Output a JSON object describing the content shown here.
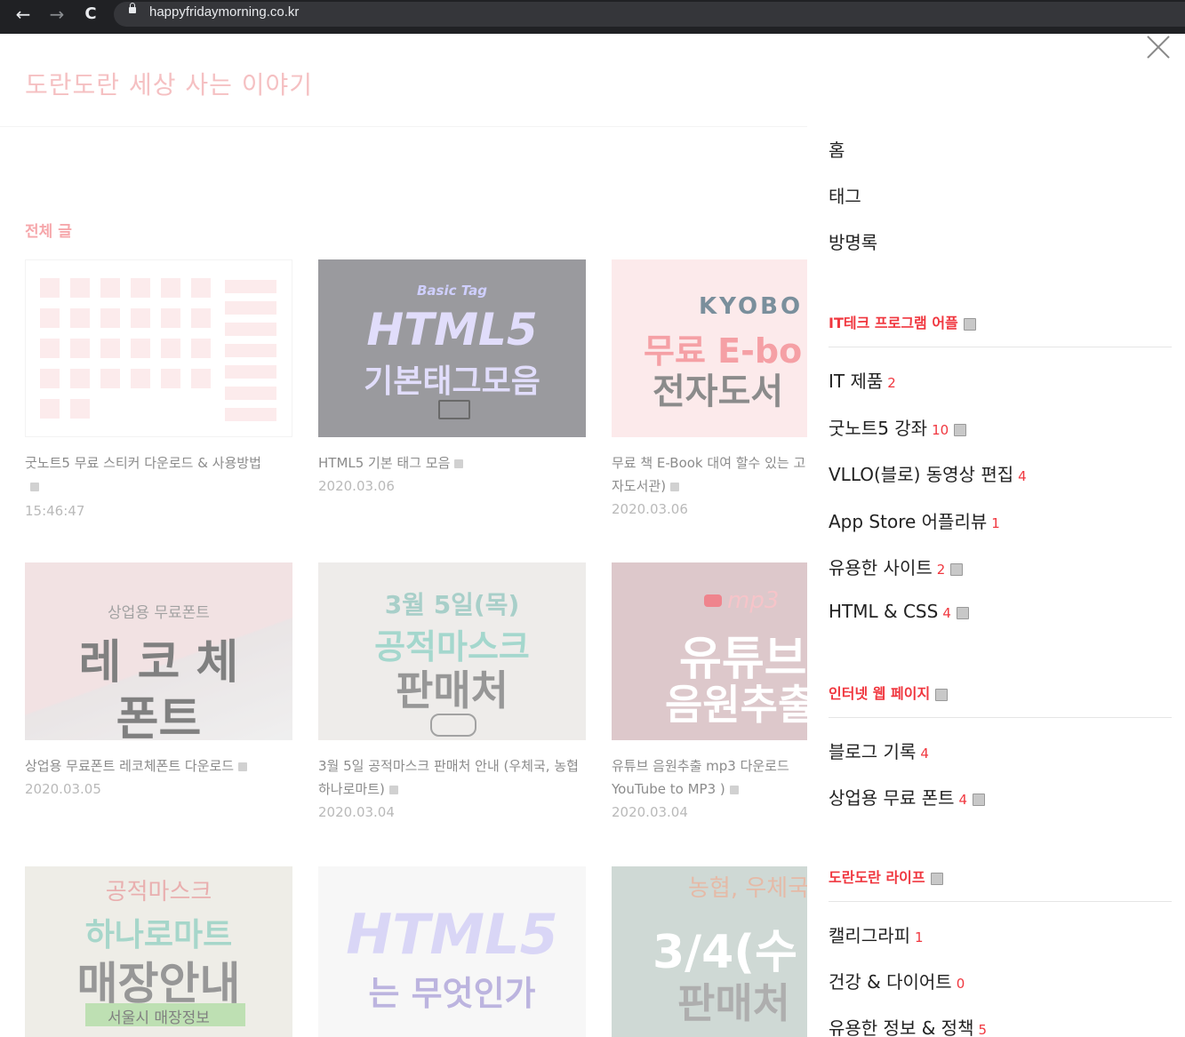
{
  "browser": {
    "url": "happyfridaymorning.co.kr",
    "back": "←",
    "forward": "→",
    "reload": "C"
  },
  "blog": {
    "title": "도란도란 세상 사는 이야기"
  },
  "section": {
    "title": "전체 글"
  },
  "posts": [
    {
      "title": "굿노트5 무료 스티커 다운로드 & 사용방법",
      "date": "15:46:47"
    },
    {
      "title": "HTML5 기본 태그 모음",
      "date": "2020.03.06",
      "thumb_small": "Basic Tag",
      "thumb_big": "HTML5",
      "thumb_sub": "기본태그모음"
    },
    {
      "title": "무료 책 E-Book 대여 할수 있는 고 전자도서관)",
      "date": "2020.03.06",
      "thumb_small": "KYOBO",
      "thumb_big": "무료 E-bo",
      "thumb_sub": "전자도서"
    },
    {
      "title": "상업용 무료폰트 레코체폰트 다운로드",
      "date": "2020.03.05",
      "thumb_small": "상업용 무료폰트",
      "thumb_big": "레 코 체",
      "thumb_sub": "폰트"
    },
    {
      "title": "3월 5일 공적마스크 판매처 안내 (우체국, 농협 하나로마트)",
      "date": "2020.03.04",
      "thumb_small": "3월 5일(목)",
      "thumb_big": "공적마스크",
      "thumb_sub": "판매처"
    },
    {
      "title": "유튜브 음원추출 mp3 다운로드 YouTube to MP3 )",
      "date": "2020.03.04",
      "thumb_small": "mp3",
      "thumb_big": "유튜브",
      "thumb_sub": "음원추출"
    },
    {
      "title": "",
      "date": "",
      "thumb_small": "공적마스크",
      "thumb_big": "하나로마트",
      "thumb_sub": "매장안내",
      "thumb_tag": "서울시 매장정보"
    },
    {
      "title": "",
      "date": "",
      "thumb_big": "HTML5",
      "thumb_sub": "는 무엇인가"
    },
    {
      "title": "",
      "date": "",
      "thumb_small": "농협, 우체국",
      "thumb_big": "3/4(수",
      "thumb_sub": "판매처"
    }
  ],
  "sidebar": {
    "menu": [
      "홈",
      "태그",
      "방명록"
    ],
    "categories": [
      {
        "name": "IT테크 프로그램 어플",
        "new": true,
        "items": [
          {
            "label": "IT 제품",
            "count": "2",
            "new": false
          },
          {
            "label": "굿노트5 강좌",
            "count": "10",
            "new": true
          },
          {
            "label": "VLLO(블로) 동영상 편집",
            "count": "4",
            "new": false
          },
          {
            "label": "App Store 어플리뷰",
            "count": "1",
            "new": false
          },
          {
            "label": "유용한 사이트",
            "count": "2",
            "new": true
          },
          {
            "label": "HTML & CSS",
            "count": "4",
            "new": true
          }
        ]
      },
      {
        "name": "인터넷 웹 페이지",
        "new": true,
        "items": [
          {
            "label": "블로그 기록",
            "count": "4",
            "new": false
          },
          {
            "label": "상업용 무료 폰트",
            "count": "4",
            "new": true
          }
        ]
      },
      {
        "name": "도란도란 라이프",
        "new": true,
        "items": [
          {
            "label": "캘리그라피",
            "count": "1",
            "new": false
          },
          {
            "label": "건강 & 다이어트",
            "count": "0",
            "new": false
          },
          {
            "label": "유용한 정보 & 정책",
            "count": "5",
            "new": false
          }
        ]
      }
    ]
  },
  "colors": {
    "accent": "#f0373f",
    "logo": "#f0a3a6"
  },
  "icons": {
    "close": "close-icon",
    "lock": "lock-icon",
    "new_badge": "new-badge-icon"
  }
}
